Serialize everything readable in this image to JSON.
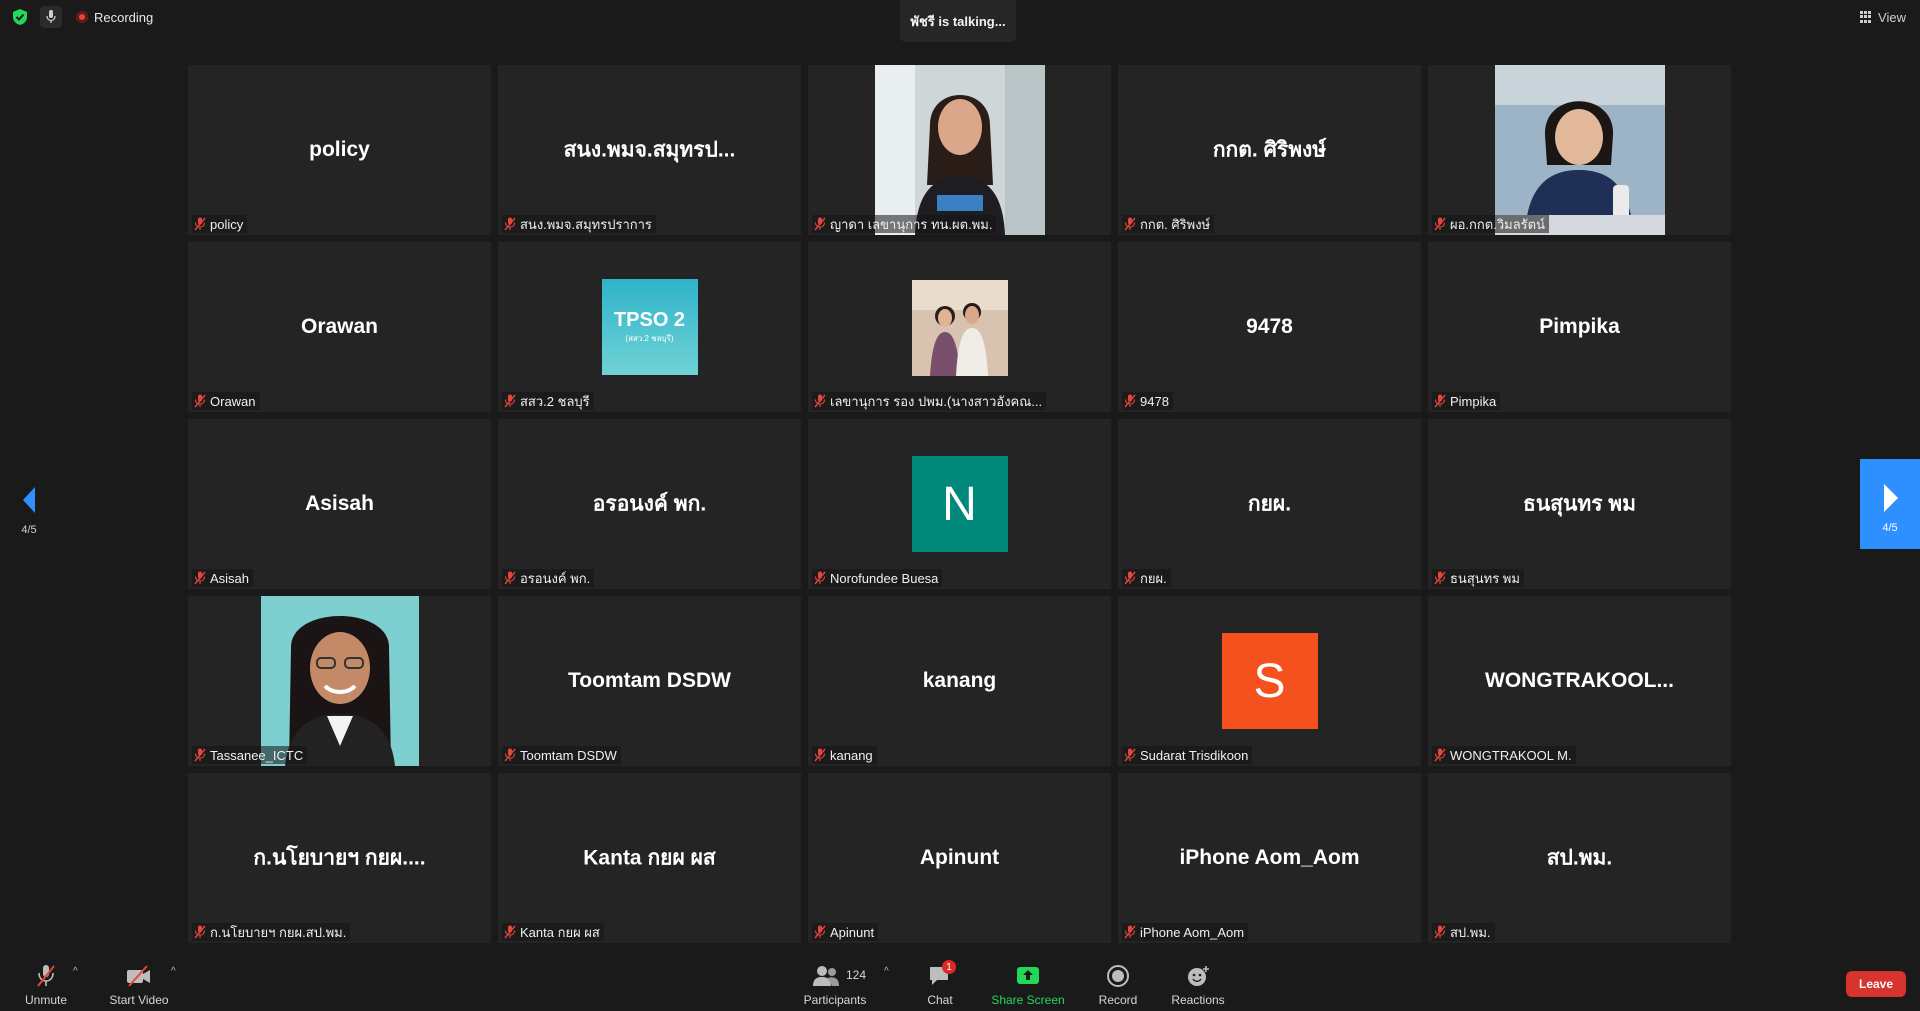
{
  "top_bar": {
    "recording_label": "Recording",
    "talking_indicator": "พัชรี is talking...",
    "view_label": "View"
  },
  "pagination": {
    "left_page": "4/5",
    "right_page": "4/5"
  },
  "tiles": [
    {
      "display": "policy",
      "label": "policy",
      "type": "text"
    },
    {
      "display": "สนง.พมจ.สมุทรป...",
      "label": "สนง.พมจ.สมุทรปราการ",
      "type": "text"
    },
    {
      "display": "",
      "label": "ญาดา เลขานุการ ทน.ผต.พม.",
      "type": "photo",
      "photo": "woman-black-tshirt"
    },
    {
      "display": "กกต. ศิริพงษ์",
      "label": "กกต. ศิริพงษ์",
      "type": "text"
    },
    {
      "display": "",
      "label": "ผอ.กกต.วิมลรัตน์",
      "type": "photo",
      "photo": "woman-navy-blazer"
    },
    {
      "display": "Orawan",
      "label": "Orawan",
      "type": "text"
    },
    {
      "display": "",
      "label": "สสว.2 ชลบุรี",
      "type": "logo",
      "logo_text": "TPSO 2",
      "logo_sub": "(สสว.2 ชลบุรี)"
    },
    {
      "display": "",
      "label": "เลขานุการ รอง ปพม.(นางสาวอังคณ...",
      "type": "photo",
      "photo": "couple"
    },
    {
      "display": "9478",
      "label": "9478",
      "type": "text"
    },
    {
      "display": "Pimpika",
      "label": "Pimpika",
      "type": "text"
    },
    {
      "display": "Asisah",
      "label": "Asisah",
      "type": "text"
    },
    {
      "display": "อรอนงค์ พก.",
      "label": "อรอนงค์ พก.",
      "type": "text"
    },
    {
      "display": "",
      "label": "Norofundee Buesa",
      "type": "avatar",
      "letter": "N",
      "color": "#00897b"
    },
    {
      "display": "กยผ.",
      "label": "กยผ.",
      "type": "text"
    },
    {
      "display": "ธนสุนทร พม",
      "label": "ธนสุนทร พม",
      "type": "text"
    },
    {
      "display": "",
      "label": "Tassanee_ICTC",
      "type": "photo",
      "photo": "woman-glasses"
    },
    {
      "display": "Toomtam DSDW",
      "label": "Toomtam DSDW",
      "type": "text"
    },
    {
      "display": "kanang",
      "label": "kanang",
      "type": "text"
    },
    {
      "display": "",
      "label": "Sudarat Trisdikoon",
      "type": "avatar",
      "letter": "S",
      "color": "#f4511e"
    },
    {
      "display": "WONGTRAKOOL...",
      "label": "WONGTRAKOOL M.",
      "type": "text"
    },
    {
      "display": "ก.นโยบายฯ กยผ....",
      "label": "ก.นโยบายฯ กยผ.สป.พม.",
      "type": "text"
    },
    {
      "display": "Kanta  กยผ ผส",
      "label": "Kanta  กยผ ผส",
      "type": "text"
    },
    {
      "display": "Apinunt",
      "label": "Apinunt",
      "type": "text"
    },
    {
      "display": "iPhone Aom_Aom",
      "label": "iPhone Aom_Aom",
      "type": "text"
    },
    {
      "display": "สป.พม.",
      "label": "สป.พม.",
      "type": "text"
    }
  ],
  "toolbar": {
    "unmute_label": "Unmute",
    "start_video_label": "Start Video",
    "participants_label": "Participants",
    "participants_count": "124",
    "chat_label": "Chat",
    "chat_badge": "1",
    "share_screen_label": "Share Screen",
    "record_label": "Record",
    "reactions_label": "Reactions",
    "leave_label": "Leave"
  },
  "colors": {
    "background": "#1a1a1a",
    "tile": "#242424",
    "accent_blue": "#2e8fff",
    "share_green": "#23d959",
    "leave_red": "#d6342c",
    "mute_red": "#e5453a"
  }
}
